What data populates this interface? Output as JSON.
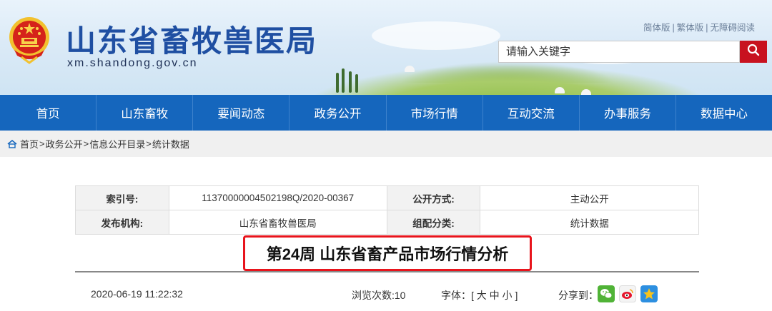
{
  "header": {
    "site_title": "山东省畜牧兽医局",
    "site_domain": "xm.shandong.gov.cn",
    "top_links": [
      "简体版",
      "繁体版",
      "无障碍阅读"
    ],
    "top_links_separator": "|",
    "search_placeholder": "请输入关键字"
  },
  "nav": {
    "items": [
      "首页",
      "山东畜牧",
      "要闻动态",
      "政务公开",
      "市场行情",
      "互动交流",
      "办事服务",
      "数据中心"
    ]
  },
  "breadcrumb": {
    "items": [
      "首页",
      "政务公开",
      "信息公开目录",
      "统计数据"
    ],
    "separator": ">"
  },
  "info": {
    "index_label": "索引号:",
    "index_value": "11370000004502198Q/2020-00367",
    "open_mode_label": "公开方式:",
    "open_mode_value": "主动公开",
    "publisher_label": "发布机构:",
    "publisher_value": "山东省畜牧兽医局",
    "category_label": "组配分类:",
    "category_value": "统计数据"
  },
  "article": {
    "title": "第24周 山东省畜产品市场行情分析",
    "date": "2020-06-19 11:22:32",
    "views": "浏览次数:10",
    "font_size_label": "字体：[ 大 中 小 ]",
    "share_label": "分享到："
  },
  "colors": {
    "nav_blue": "#1566bd",
    "title_blue": "#1f4fa2",
    "search_red": "#c8121f",
    "highlight_red": "#e8141c"
  },
  "icons": {
    "search": "search-icon",
    "home": "home-icon",
    "share": [
      "wechat-icon",
      "weibo-icon",
      "qzone-icon"
    ]
  }
}
